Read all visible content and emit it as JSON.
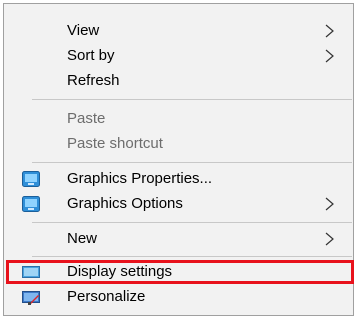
{
  "menu": {
    "items": [
      {
        "label": "View",
        "has_submenu": true,
        "enabled": true
      },
      {
        "label": "Sort by",
        "has_submenu": true,
        "enabled": true
      },
      {
        "label": "Refresh",
        "has_submenu": false,
        "enabled": true
      },
      {
        "label": "Paste",
        "has_submenu": false,
        "enabled": false
      },
      {
        "label": "Paste shortcut",
        "has_submenu": false,
        "enabled": false
      },
      {
        "label": "Graphics Properties...",
        "has_submenu": false,
        "enabled": true,
        "icon": "intel-graphics-icon"
      },
      {
        "label": "Graphics Options",
        "has_submenu": true,
        "enabled": true,
        "icon": "intel-graphics-icon"
      },
      {
        "label": "New",
        "has_submenu": true,
        "enabled": true
      },
      {
        "label": "Display settings",
        "has_submenu": false,
        "enabled": true,
        "icon": "display-icon",
        "highlighted": true
      },
      {
        "label": "Personalize",
        "has_submenu": false,
        "enabled": true,
        "icon": "personalize-icon"
      }
    ]
  },
  "colors": {
    "menu_background": "#f2f2f2",
    "highlight_border": "#e8121c",
    "disabled_text": "#6d6d6d"
  }
}
